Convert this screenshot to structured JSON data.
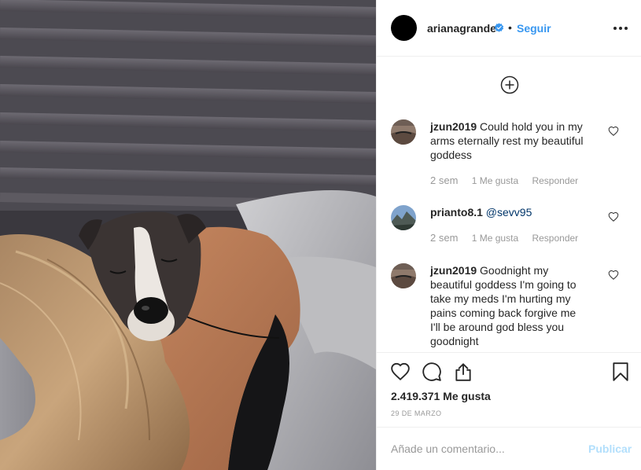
{
  "post": {
    "image_alt": "Dog sleeping on a person's shoulder in bed"
  },
  "header": {
    "username": "arianagrande",
    "verified": true,
    "separator": "•",
    "follow_label": "Seguir",
    "more_icon": "more-dots-icon"
  },
  "comments": {
    "load_more_icon": "plus-circle-icon",
    "items": [
      {
        "username": "jzun2019",
        "text": "Could hold you in my arms eternally rest my beautiful goddess",
        "time": "2 sem",
        "likes": "1 Me gusta",
        "reply": "Responder"
      },
      {
        "username": "prianto8.1",
        "mention": "@sevv95",
        "time": "2 sem",
        "likes": "1 Me gusta",
        "reply": "Responder"
      },
      {
        "username": "jzun2019",
        "text": "Goodnight my beautiful goddess I'm going to take my meds I'm hurting my pains coming back forgive me I'll be around god bless you goodnight"
      }
    ]
  },
  "actions": {
    "like_icon": "heart-icon",
    "comment_icon": "comment-icon",
    "share_icon": "share-icon",
    "save_icon": "bookmark-icon",
    "likes_count": "2.419.371 Me gusta",
    "date": "29 DE MARZO"
  },
  "add_comment": {
    "placeholder": "Añade un comentario...",
    "publish_label": "Publicar"
  },
  "colors": {
    "link": "#3897f0",
    "publish_disabled": "#b2dffc",
    "meta": "#999999",
    "border": "#efefef"
  }
}
